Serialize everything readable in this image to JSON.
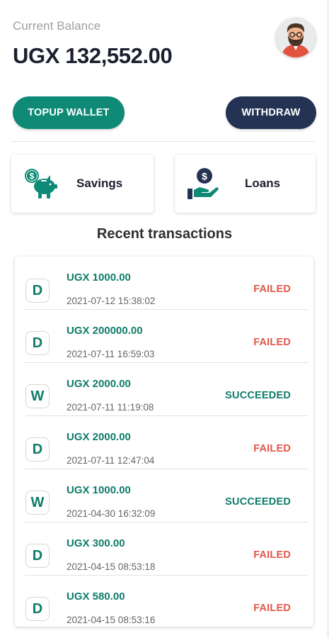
{
  "header": {
    "balance_label": "Current Balance",
    "balance_value": "UGX 132,552.00"
  },
  "actions": {
    "topup_label": "TOPUP WALLET",
    "withdraw_label": "WITHDRAW"
  },
  "cards": {
    "savings_label": "Savings",
    "loans_label": "Loans"
  },
  "transactions_title": "Recent transactions",
  "transactions": [
    {
      "type": "D",
      "amount": "UGX 1000.00",
      "date": "2021-07-12 15:38:02",
      "status": "FAILED"
    },
    {
      "type": "D",
      "amount": "UGX 200000.00",
      "date": "2021-07-11 16:59:03",
      "status": "FAILED"
    },
    {
      "type": "W",
      "amount": "UGX 2000.00",
      "date": "2021-07-11 11:19:08",
      "status": "SUCCEEDED"
    },
    {
      "type": "D",
      "amount": "UGX 2000.00",
      "date": "2021-07-11 12:47:04",
      "status": "FAILED"
    },
    {
      "type": "W",
      "amount": "UGX 1000.00",
      "date": "2021-04-30 16:32:09",
      "status": "SUCCEEDED"
    },
    {
      "type": "D",
      "amount": "UGX 300.00",
      "date": "2021-04-15 08:53:18",
      "status": "FAILED"
    },
    {
      "type": "D",
      "amount": "UGX 580.00",
      "date": "2021-04-15 08:53:16",
      "status": "FAILED"
    }
  ],
  "colors": {
    "primary_green": "#0e8a76",
    "navy": "#243354",
    "failed_red": "#e0574a",
    "text_dark": "#1c1f2e"
  },
  "icons": {
    "avatar": "avatar-bearded-man",
    "savings": "piggy-bank-dollar-icon",
    "loans": "hand-dollar-coin-icon"
  }
}
